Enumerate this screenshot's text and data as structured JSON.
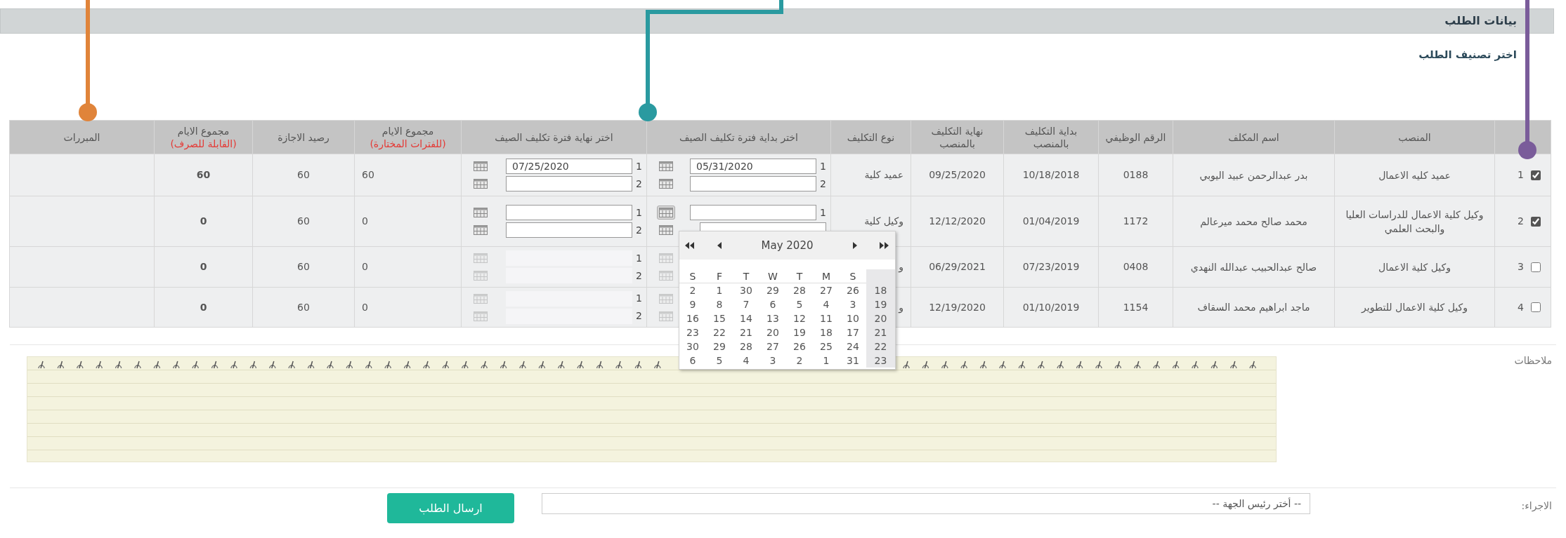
{
  "section_title": "بيانات الطلب",
  "category_label": "اختر تصنيف الطلب",
  "table": {
    "columns": [
      {
        "label": "المنصب"
      },
      {
        "label": "اسم المكلف"
      },
      {
        "label": "الرقم الوظيفي"
      },
      {
        "label": "بداية التكليف بالمنصب"
      },
      {
        "label": "نهاية التكليف بالمنصب"
      },
      {
        "label": "نوع التكليف"
      },
      {
        "label": "اختر بداية فترة تكليف الصيف"
      },
      {
        "label": "اختر نهاية فترة تكليف الصيف"
      },
      {
        "label": "مجموع الايام",
        "note": "(للفترات المختارة)"
      },
      {
        "label": "رصيد الاجازة"
      },
      {
        "label": "مجموع الايام",
        "note": "(القابلة للصرف)"
      },
      {
        "label": "المبررات"
      }
    ],
    "rows": [
      {
        "checked": true,
        "index": "1",
        "position": "عميد كليه الاعمال",
        "name": "بدر عبدالرحمن عبيد اليوبي",
        "employee_no": "0188",
        "start": "10/18/2018",
        "end": "09/25/2020",
        "type": "عميد كلية",
        "disabled": false,
        "summer_start": [
          {
            "kind": "field",
            "label": "1",
            "value": "05/31/2020",
            "active": false
          },
          {
            "kind": "field",
            "label": "2",
            "active": false
          }
        ],
        "summer_end": [
          {
            "kind": "field",
            "label": "1",
            "value": "07/25/2020",
            "active": false
          },
          {
            "kind": "field",
            "label": "2",
            "active": false
          }
        ],
        "selected_days": "60",
        "balance": "60",
        "payable_days": "60"
      },
      {
        "checked": true,
        "index": "2",
        "position": "وكيل كلية الاعمال للدراسات العليا والبحث العلمي",
        "name": "محمد صالح محمد ميرعالم",
        "employee_no": "1172",
        "start": "01/04/2019",
        "end": "12/12/2020",
        "type": "وكيل كلية",
        "disabled": false,
        "summer_start": [
          {
            "kind": "field",
            "label": "1",
            "active": true
          },
          {
            "kind": "field",
            "active": false
          }
        ],
        "summer_end": [
          {
            "kind": "field",
            "label": "1",
            "active": false
          },
          {
            "kind": "field",
            "label": "2",
            "active": false
          }
        ],
        "selected_days": "0",
        "balance": "60",
        "payable_days": "0"
      },
      {
        "checked": false,
        "index": "3",
        "position": "وكيل كلية الاعمال",
        "name": "صالح عبدالحبيب عبدالله النهدي",
        "employee_no": "0408",
        "start": "07/23/2019",
        "end": "06/29/2021",
        "type": "و",
        "disabled": true,
        "summer_start": [
          {
            "kind": "button",
            "active": false
          },
          {
            "kind": "button",
            "active": false
          }
        ],
        "summer_end": [
          {
            "kind": "field",
            "label": "1",
            "active": false
          },
          {
            "kind": "field",
            "label": "2",
            "active": false
          }
        ],
        "selected_days": "0",
        "balance": "60",
        "payable_days": "0"
      },
      {
        "checked": false,
        "index": "4",
        "position": "وكيل كلية الاعمال للتطوير",
        "name": "ماجد ابراهيم محمد السقاف",
        "employee_no": "1154",
        "start": "01/10/2019",
        "end": "12/19/2020",
        "type": "و",
        "disabled": true,
        "summer_start": [
          {
            "kind": "button",
            "active": false
          },
          {
            "kind": "button",
            "active": false
          }
        ],
        "summer_end": [
          {
            "kind": "field",
            "label": "1",
            "active": false
          },
          {
            "kind": "field",
            "label": "2",
            "active": false
          }
        ],
        "selected_days": "0",
        "balance": "60",
        "payable_days": "0"
      }
    ]
  },
  "calendar": {
    "title": "May 2020",
    "weekdays": [
      "S",
      "M",
      "T",
      "W",
      "T",
      "F",
      "S"
    ],
    "weeks": [
      {
        "week": "18",
        "days": [
          "26",
          "27",
          "28",
          "29",
          "30",
          "1",
          "2"
        ]
      },
      {
        "week": "19",
        "days": [
          "3",
          "4",
          "5",
          "6",
          "7",
          "8",
          "9"
        ]
      },
      {
        "week": "20",
        "days": [
          "10",
          "11",
          "12",
          "13",
          "14",
          "15",
          "16"
        ]
      },
      {
        "week": "21",
        "days": [
          "17",
          "18",
          "19",
          "20",
          "21",
          "22",
          "23"
        ]
      },
      {
        "week": "22",
        "days": [
          "24",
          "25",
          "26",
          "27",
          "28",
          "29",
          "30"
        ]
      },
      {
        "week": "23",
        "days": [
          "31",
          "1",
          "2",
          "3",
          "4",
          "5",
          "6"
        ]
      }
    ]
  },
  "notes_label": "ملاحظات",
  "action": {
    "label": "الاجراء:",
    "value": "-- أختر رئيس الجهة --",
    "submit": "ارسال الطلب"
  },
  "callouts": [
    {
      "kind": "straight",
      "color": "#e0843a"
    },
    {
      "kind": "elbow",
      "color": "#2a9aa0"
    },
    {
      "kind": "straight",
      "color": "#7a5c9a"
    }
  ]
}
